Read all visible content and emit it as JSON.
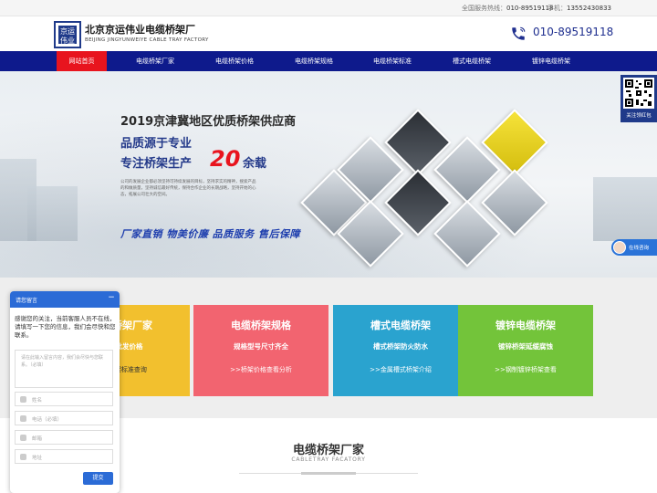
{
  "topbar": {
    "hotline_label": "全国服务热线：",
    "hotline": "010-89519118",
    "mobile_label": "手机：",
    "mobile": "13552430833"
  },
  "header": {
    "logo_text": "京运伟业",
    "company_cn": "北京京运伟业电缆桥架厂",
    "company_en": "BEIJING JINGYUNWEIYE CABLE TRAY FACTORY",
    "phone": "010-89519118"
  },
  "nav": {
    "items": [
      {
        "label": "网站首页"
      },
      {
        "label": "电缆桥架厂家"
      },
      {
        "label": "电缆桥架价格"
      },
      {
        "label": "电缆桥架规格"
      },
      {
        "label": "电缆桥架标准"
      },
      {
        "label": "槽式电缆桥架"
      },
      {
        "label": "镀锌电缆桥架"
      }
    ]
  },
  "banner": {
    "title": "2019京津冀地区优质桥架供应商",
    "line1": "品质源于专业",
    "line2": "专注桥架生产",
    "highlight": "20",
    "line2_suffix": "余载",
    "desc": "公司的发展企业都必须坚持可持续发展的目标，坚持求实的精神，搜索产品的和做质量，坚持诚信最好传统，保持合作企业的长期战略，坚持开始的心态，拓展公司壮大的空间。",
    "slogan": "厂家直销  物美价廉  品质服务  售后保障"
  },
  "float": {
    "qr_label": "关注领红包",
    "online_chat": "在线咨询"
  },
  "features": [
    {
      "title": "电缆桥架厂家",
      "subtitle": "直销批发价格",
      "link": ">>桥架标准查询",
      "bg": "#f2c02e",
      "link_color": "#333333"
    },
    {
      "title": "电缆桥架规格",
      "subtitle": "规格型号尺寸齐全",
      "link": ">>桥架价格查看分析",
      "bg": "#f26470",
      "link_color": "#ffffff"
    },
    {
      "title": "槽式电缆桥架",
      "subtitle": "槽式桥架防火防水",
      "link": ">>金属槽式桥架介绍",
      "bg": "#2aa3cf",
      "link_color": "#ffffff"
    },
    {
      "title": "镀锌电缆桥架",
      "subtitle": "镀锌桥架延缓腐蚀",
      "link": ">>钢制镀锌桥架查看",
      "bg": "#73c43a",
      "link_color": "#ffffff"
    }
  ],
  "section": {
    "title": "电缆桥架厂家",
    "subtitle": "CABLETRAY FACATORY"
  },
  "chat": {
    "title": "请您留言",
    "minimize": "−",
    "message": "感谢您的关注，当前客服人员不在线，请填写一下您的信息，我们会尽快和您联系。",
    "textarea_placeholder": "请在此输入留言内容，我们会尽快与您联系。（必填）",
    "fields": [
      {
        "placeholder": "姓名"
      },
      {
        "placeholder": "电话（必填）"
      },
      {
        "placeholder": "邮箱"
      },
      {
        "placeholder": "地址"
      }
    ],
    "submit": "提交"
  }
}
